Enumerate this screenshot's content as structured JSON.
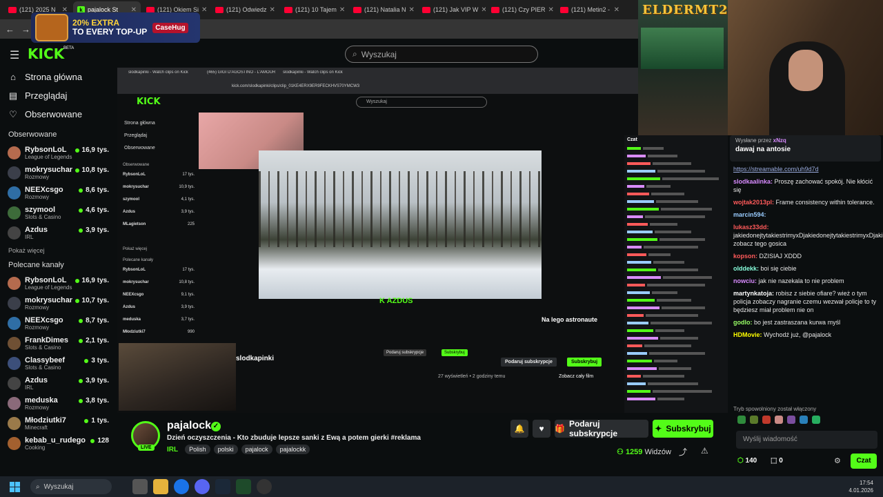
{
  "browser": {
    "tabs": [
      {
        "label": "(121) 2025 N",
        "kind": "yt"
      },
      {
        "label": "pajalock St",
        "kind": "kick",
        "active": true
      },
      {
        "label": "(121) Okiem Si",
        "kind": "yt"
      },
      {
        "label": "(121) Odwiedz",
        "kind": "yt"
      },
      {
        "label": "(121) 10 Tajem",
        "kind": "yt"
      },
      {
        "label": "(121) Natalia N",
        "kind": "yt"
      },
      {
        "label": "(121) Jak VIP W",
        "kind": "yt"
      },
      {
        "label": "(121) Czy PIER",
        "kind": "yt"
      },
      {
        "label": "(121) Metin2 -",
        "kind": "yt"
      }
    ]
  },
  "ad": {
    "promo_pct": "20% EXTRA",
    "promo_rest": "TO EVERY TOP-UP",
    "brand": "CaseHug"
  },
  "header": {
    "logo": "KICK",
    "logo_sup": "BETA",
    "search_placeholder": "Wyszukaj"
  },
  "sidebar": {
    "nav": [
      {
        "label": "Strona główna",
        "icon": "home-icon"
      },
      {
        "label": "Przeglądaj",
        "icon": "browse-icon"
      },
      {
        "label": "Obserwowane",
        "icon": "heart-icon"
      }
    ],
    "followed_title": "Obserwowane",
    "followed": [
      {
        "name": "RybsonLoL",
        "cat": "League of Legends",
        "viewers": "16,9 tys.",
        "color": "#b56b4e"
      },
      {
        "name": "mokrysuchar",
        "cat": "Rozmowy",
        "viewers": "10,8 tys.",
        "color": "#3b3f4a"
      },
      {
        "name": "NEEXcsgo",
        "cat": "Rozmowy",
        "viewers": "8,6 tys.",
        "color": "#2f6ea5"
      },
      {
        "name": "szymool",
        "cat": "Slots & Casino",
        "viewers": "4,6 tys.",
        "color": "#3d6b3a"
      },
      {
        "name": "Azdus",
        "cat": "IRL",
        "viewers": "3,9 tys.",
        "color": "#444"
      }
    ],
    "show_more": "Pokaż więcej",
    "recommended_title": "Polecane kanały",
    "recommended": [
      {
        "name": "RybsonLoL",
        "cat": "League of Legends",
        "viewers": "16,9 tys.",
        "color": "#b56b4e"
      },
      {
        "name": "mokrysuchar",
        "cat": "Rozmowy",
        "viewers": "10,7 tys.",
        "color": "#3b3f4a"
      },
      {
        "name": "NEEXcsgo",
        "cat": "Rozmowy",
        "viewers": "8,7 tys.",
        "color": "#2f6ea5"
      },
      {
        "name": "FrankDimes",
        "cat": "Slots & Casino",
        "viewers": "2,1 tys.",
        "color": "#6f5034"
      },
      {
        "name": "Classybeef",
        "cat": "Slots & Casino",
        "viewers": "3 tys.",
        "color": "#3c4f7a"
      },
      {
        "name": "Azdus",
        "cat": "IRL",
        "viewers": "3,9 tys.",
        "color": "#444"
      },
      {
        "name": "meduska",
        "cat": "Rozmowy",
        "viewers": "3,8 tys.",
        "color": "#8a6a7a"
      },
      {
        "name": "Młodziutki7",
        "cat": "Minecraft",
        "viewers": "1 tys.",
        "color": "#9a7a4a"
      },
      {
        "name": "kebab_u_rudego",
        "cat": "Cooking",
        "viewers": "128",
        "color": "#a3602f"
      }
    ]
  },
  "overlay": {
    "brand": "ELDERMT2",
    "inner_live": "Na lego astronaute",
    "inner_channel": "slodkapinki",
    "inner_overlay_text": "K AZDUS",
    "inner_views": "27 wyświetleń",
    "inner_time": "2 godziny temu",
    "inner_full": "Zobacz cały film",
    "inner_sub": "Subskrybuj",
    "inner_gift": "Podaruj subskrypcje",
    "inner_search": "Wyszukaj",
    "inner_url": "kick.com/slodkapinki/clips/clip_01KE4ERX9ER9FECKHVS70YMCW3",
    "inner_tab1": "slodkapinki - Watch clips on Kick",
    "inner_tab2": "(465) GIGI D'AGOSTINO - L'AMOUR",
    "inner_tab3": "slodkapinki - Watch clips on Kick",
    "inner_nav": [
      "Strona główna",
      "Przeglądaj",
      "Obserwowane"
    ],
    "inner_followed_title": "Obserwowane",
    "inner_followed": [
      [
        "RybsonLoL",
        "League of Legends",
        "17 tys."
      ],
      [
        "mokrysuchar",
        "Rozmowy",
        "10,9 tys."
      ],
      [
        "szymool",
        "Slots & Casino",
        "4,1 tys."
      ],
      [
        "Azdus",
        "IRL",
        "3,9 tys."
      ],
      [
        "MLagietson",
        "",
        "225"
      ]
    ],
    "inner_show_more": "Pokaż więcej",
    "inner_rec_title": "Polecane kanały",
    "inner_rec": [
      [
        "RybsonLoL",
        "League of Legends",
        "17 tys."
      ],
      [
        "mokrysuchar",
        "Rozmowy",
        "10,8 tys."
      ],
      [
        "NEEXcsgo",
        "Rozmowy",
        "9,1 tys."
      ],
      [
        "Azdus",
        "IRL",
        "3,9 tys."
      ],
      [
        "meduska",
        "Rozmowy",
        "3,7 tys."
      ],
      [
        "Młodziutki7",
        "",
        "990"
      ]
    ],
    "inner_chat_title": "Czat",
    "inner_pinned": "dawaj na antosie"
  },
  "stream": {
    "channel": "pajalock",
    "title": "Dzień oczyszczenia - Kto zbuduje lepsze sanki z Ewą a potem gierki #reklama",
    "live_badge": "LIVE",
    "tags": [
      "IRL",
      "Polish",
      "polski",
      "pajalock",
      "pajalockk"
    ],
    "gift_label": "Podaruj subskrypcje",
    "sub_label": "Subskrybuj",
    "viewers": "1259",
    "viewers_label": "Widzów"
  },
  "chat": {
    "pinned_by": "Wysłane przez",
    "pinned_user": "xNzq",
    "pinned_text": "dawaj na antosie",
    "messages": [
      {
        "user": "",
        "text": "https://streamable.com/uh9d7d",
        "color": "#9ad"
      },
      {
        "user": "slodkaalinka:",
        "text": "Proszę zachować spokój. Nie kłócić się",
        "color": "#d98cff"
      },
      {
        "user": "wojtak2013pl:",
        "text": "Frame consistency within tolerance.",
        "color": "#ff5a5a"
      },
      {
        "user": "marcin594:",
        "text": "",
        "color": "#9cf"
      },
      {
        "user": "lukasz33dd:",
        "text": "jakiedonejtytakiestrimyxDjakiedonejtytakiestrimyxDjakiedonejtytakiestrimyxDjakiedonejtytakiestrimyxDjakiedonejtytakiestrimyxDjakiedonejtytakiestrimyxD zobacz tego gosica",
        "color": "#ff5a5a"
      },
      {
        "user": "kopson:",
        "text": "DZISIAJ XDDD",
        "color": "#ff5a5a"
      },
      {
        "user": "olddekk:",
        "text": "boi się ciebie",
        "color": "#8fd"
      },
      {
        "user": "nowciu:",
        "text": "jak nie nazekala to nie problem",
        "color": "#d98cff"
      },
      {
        "user": "martynkatoja:",
        "text": "robisz z siebie ofiare? wież o tym policja zobaczy nagranie czemu wezwał policje to ty będziesz miał problem nie on",
        "color": "#fff"
      },
      {
        "user": "godlo:",
        "text": "bo jest zastraszana kurwa myśl",
        "color": "#9f6"
      },
      {
        "user": "HDMovie:",
        "text": "Wychodź już, @pajalock",
        "color": "#ff0"
      }
    ],
    "system": "Tryb spowolniony został włączony",
    "input_placeholder": "Wyślij wiadomość",
    "points": "140",
    "gifts": "0",
    "send_label": "Czat"
  },
  "taskbar": {
    "search": "Wyszukaj",
    "time": "17:54",
    "date": "4.01.2026"
  }
}
